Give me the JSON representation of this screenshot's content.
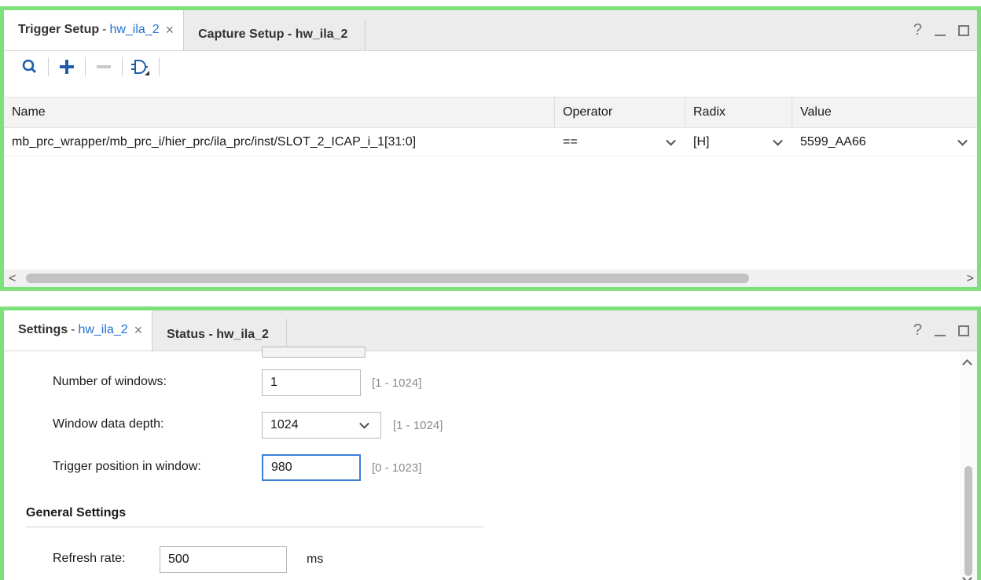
{
  "trigger_panel": {
    "tabs": [
      {
        "title": "Trigger Setup",
        "sep": "-",
        "id": "hw_ila_2",
        "close": "×"
      },
      {
        "title": "Capture Setup - hw_ila_2"
      }
    ],
    "window_controls": {
      "help": "?"
    },
    "toolbar": {
      "buttons": [
        "search-icon",
        "add-icon",
        "remove-icon",
        "gate-icon"
      ]
    },
    "table": {
      "headers": [
        "Name",
        "Operator",
        "Radix",
        "Value"
      ],
      "rows": [
        {
          "name": "mb_prc_wrapper/mb_prc_i/hier_prc/ila_prc/inst/SLOT_2_ICAP_i_1[31:0]",
          "operator": "==",
          "radix": "[H]",
          "value": "5599_AA66"
        }
      ]
    },
    "scroll": {
      "left": "<",
      "right": ">"
    }
  },
  "settings_panel": {
    "tabs": [
      {
        "title": "Settings",
        "sep": "-",
        "id": "hw_ila_2",
        "close": "×"
      },
      {
        "title": "Status - hw_ila_2"
      }
    ],
    "window_controls": {
      "help": "?"
    },
    "fields": {
      "num_windows": {
        "label": "Number of windows:",
        "value": "1",
        "range": "[1 - 1024]"
      },
      "window_depth": {
        "label": "Window data depth:",
        "value": "1024",
        "range": "[1 - 1024]"
      },
      "trigger_pos": {
        "label": "Trigger position in window:",
        "value": "980",
        "range": "[0 - 1023]"
      }
    },
    "general": {
      "title": "General Settings",
      "refresh": {
        "label": "Refresh rate:",
        "value": "500",
        "unit": "ms"
      }
    }
  },
  "colors": {
    "panel_border": "#7de07a",
    "tab_id": "#1f6fd6",
    "focus": "#3c7fd6"
  }
}
